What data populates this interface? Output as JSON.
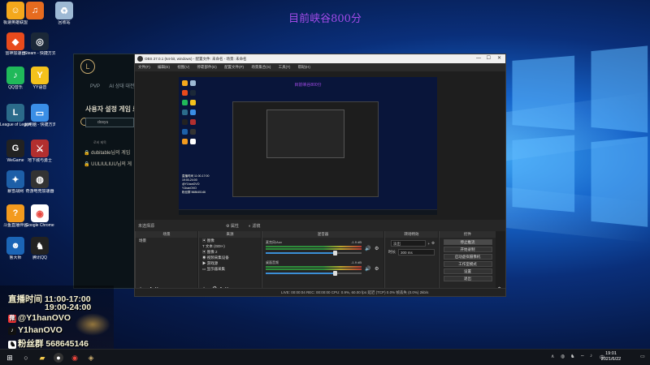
{
  "colors": {
    "accent_purple": "#a24be8",
    "win_blue": "#1563c9",
    "obs_bg": "#1e1e1e"
  },
  "overlay_title": "目前峡谷800分",
  "desktop_icons": [
    {
      "label": "极速英雄联盟",
      "icon": "lol-assist-icon",
      "color": "#f4a81c",
      "glyph": "☺"
    },
    {
      "label": "",
      "icon": "wegame-icon",
      "color": "#e66b1f",
      "glyph": "♫"
    },
    {
      "label": "回收站",
      "icon": "recycle-bin-icon",
      "color": "#9db9d4",
      "glyph": "♻"
    },
    {
      "label": "雷神加速器",
      "icon": "leishen-icon",
      "color": "#e84a1c",
      "glyph": "◆"
    },
    {
      "label": "Steam - 快捷方式",
      "icon": "steam-icon",
      "color": "#1b2838",
      "glyph": "◎"
    },
    {
      "label": "QQ音乐",
      "icon": "qq-music-icon",
      "color": "#20b95a",
      "glyph": "♪"
    },
    {
      "label": "YY语音",
      "icon": "yy-icon",
      "color": "#f4c21c",
      "glyph": "Y"
    },
    {
      "label": "League of Legends",
      "icon": "league-icon",
      "color": "#2b6b8a",
      "glyph": "L"
    },
    {
      "label": "此电脑 - 快捷方式",
      "icon": "this-pc-icon",
      "color": "#3a8ee6",
      "glyph": "▭"
    },
    {
      "label": "WeGame",
      "icon": "wegame-app-icon",
      "color": "#222",
      "glyph": "G"
    },
    {
      "label": "地下城与勇士",
      "icon": "dnf-icon",
      "color": "#b22f2f",
      "glyph": "⚔"
    },
    {
      "label": "暴雪战网",
      "icon": "battlenet-icon",
      "color": "#1d5fa8",
      "glyph": "✦"
    },
    {
      "label": "奇游电竞加速器",
      "icon": "qiyou-icon",
      "color": "#333",
      "glyph": "◍"
    },
    {
      "label": "斗鱼直播伴侣",
      "icon": "douyu-icon",
      "color": "#f39a1e",
      "glyph": "?"
    },
    {
      "label": "Google Chrome",
      "icon": "chrome-icon",
      "color": "#ffffff",
      "glyph": "◉"
    },
    {
      "label": "鲁大师",
      "icon": "ludashi-icon",
      "color": "#1b65b6",
      "glyph": "☻"
    },
    {
      "label": "腾讯QQ",
      "icon": "qq-icon",
      "color": "#222",
      "glyph": "♞"
    }
  ],
  "lol": {
    "tabs": [
      "PVP",
      "AI 상대 대전"
    ],
    "heading": "사용자 설정 게임 로",
    "search_value": "dosyu",
    "sub_header": "로비 제목",
    "items": [
      "dubitable님의 게임",
      "UULIULIUU님의 게"
    ]
  },
  "obs": {
    "title": "OBS 27.0.1 (64-bit, windows) - 配置文件: 未命名 - 场景: 未命名",
    "menu": [
      "文件(F)",
      "编辑(E)",
      "视图(V)",
      "停靠部件(D)",
      "配置文件(P)",
      "场景集合(S)",
      "工具(T)",
      "帮助(H)"
    ],
    "preview_title": "目前峡谷800分",
    "preview_overlay": [
      "直播时间 11:00-17:00",
      "19:00-24:00",
      "@Y1hanOVO",
      "Y1hanOVO",
      "粉丝群 568645146"
    ],
    "scene_bar_label": "未选择源",
    "scene_bar_props": "属性",
    "scene_bar_filters": "滤镜",
    "docks": {
      "scenes": {
        "title": "场景",
        "items": [
          "场景"
        ]
      },
      "sources": {
        "title": "来源",
        "items": [
          "图像",
          "文本 (GDI+)",
          "图像 2",
          "视频采集设备",
          "游戏源",
          "显示器采集"
        ]
      },
      "mixer": {
        "title": "混音器",
        "channels": [
          {
            "name": "麦克风/Aux",
            "level": "-1.9 dB",
            "volume": 0.72
          },
          {
            "name": "桌面音频",
            "level": "-1.9 dB",
            "volume": 0.72
          }
        ]
      },
      "transitions": {
        "title": "转场特效",
        "type": "淡出",
        "duration_label": "时长",
        "duration": "300 ms"
      },
      "controls": {
        "title": "控件",
        "buttons": [
          "停止推流",
          "开始录制",
          "启动虚拟摄像机",
          "工作室模式",
          "设置",
          "退出"
        ]
      }
    },
    "status": "LIVE: 00:00:04   REC: 00:00:00   CPU: 0.9%, 60.00 fps   延迟 (TCP) 0.0% 帧丢失 (0.0%) 2kb/s"
  },
  "stream_overlay": {
    "schedule_label": "直播时间",
    "schedule_1": "11:00-17:00",
    "schedule_2": "19:00-24:00",
    "weibo": "@Y1hanOVO",
    "douyin": "Y1hanOVO",
    "fans_group": "粉丝群 568645146"
  },
  "taskbar": {
    "items": [
      "windows-start-icon",
      "search-icon",
      "explorer-icon",
      "obs-icon",
      "chrome-icon",
      "league-client-icon"
    ],
    "clock_time": "19:01",
    "clock_date": "2021/6/22"
  }
}
